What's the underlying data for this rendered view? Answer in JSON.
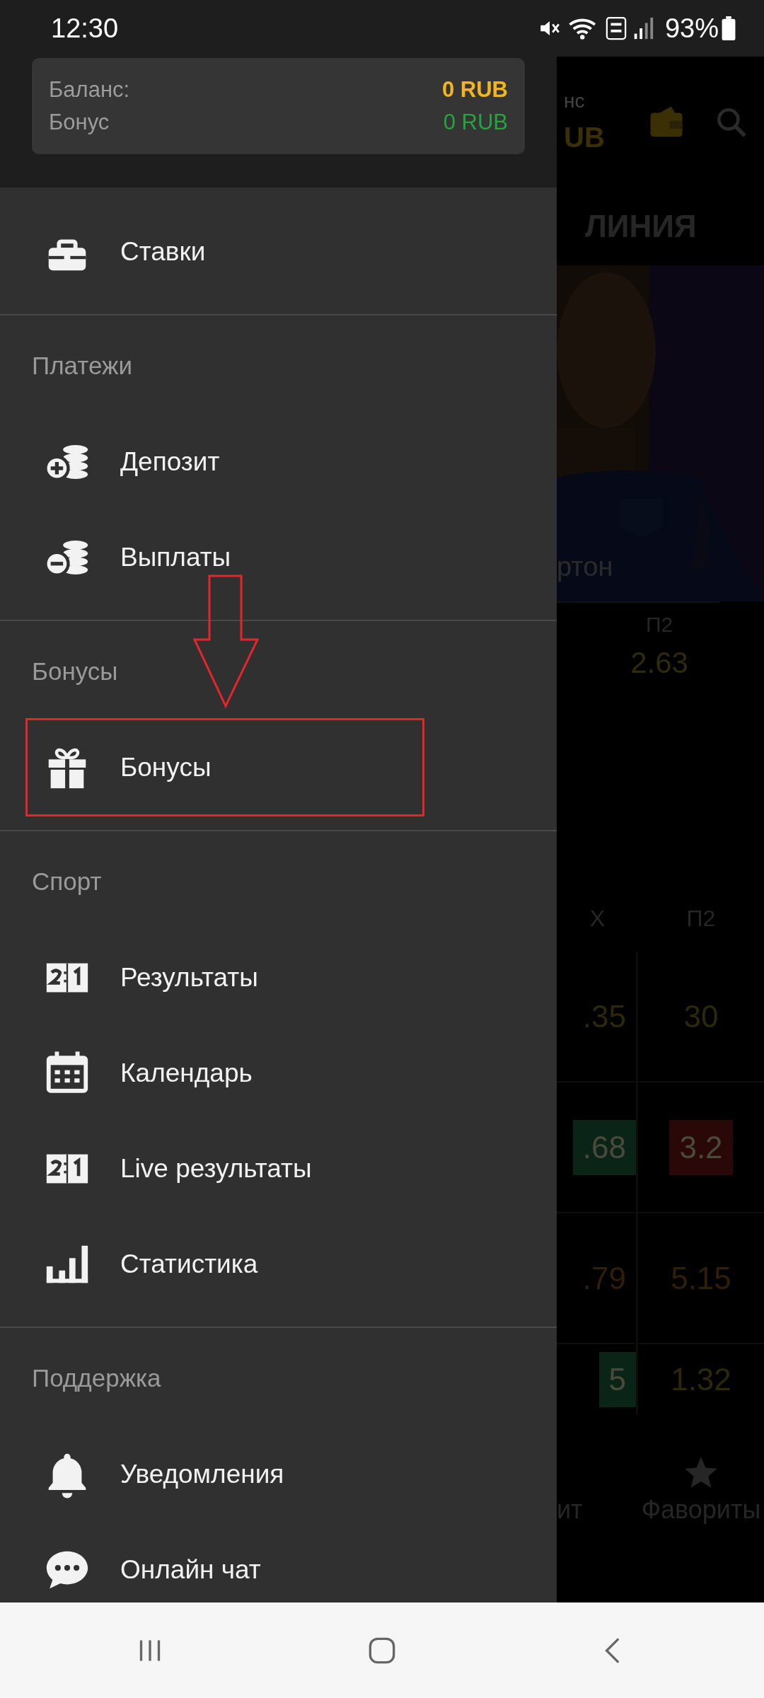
{
  "status_bar": {
    "time": "12:30",
    "battery": "93%"
  },
  "balance_card": {
    "balance_label": "Баланс:",
    "balance_value": "0 RUB",
    "bonus_label": "Бонус",
    "bonus_value": "0 RUB"
  },
  "menu": [
    {
      "items": [
        {
          "label": "Ставки",
          "highlighted": false
        }
      ]
    },
    {
      "title": "Платежи",
      "items": [
        {
          "label": "Депозит",
          "highlighted": false
        },
        {
          "label": "Выплаты",
          "highlighted": false
        }
      ]
    },
    {
      "title": "Бонусы",
      "items": [
        {
          "label": "Бонусы",
          "highlighted": true
        }
      ]
    },
    {
      "title": "Спорт",
      "items": [
        {
          "label": "Результаты",
          "highlighted": false
        },
        {
          "label": "Календарь",
          "highlighted": false
        },
        {
          "label": "Live результаты",
          "highlighted": false
        },
        {
          "label": "Статистика",
          "highlighted": false
        }
      ]
    },
    {
      "title": "Поддержка",
      "items": [
        {
          "label": "Уведомления",
          "highlighted": false
        },
        {
          "label": "Онлайн чат",
          "highlighted": false
        }
      ]
    }
  ],
  "background_app": {
    "balance_label_fragment": "нс",
    "balance_fragment": "UB",
    "tab": "ЛИНИЯ",
    "team_fragment": "ртон",
    "odds_header": "П2",
    "odds_value": "2.63",
    "table": {
      "columns": [
        "Х",
        "П2"
      ],
      "rows": [
        [
          {
            "text": ".35"
          },
          {
            "text": "30"
          }
        ],
        [
          {
            "text": ".68",
            "color": "#0b2418"
          },
          {
            "text": "3.2",
            "color": "#2a0808"
          }
        ],
        [
          {
            "text": ".79"
          },
          {
            "text": "5.15"
          }
        ],
        [
          {
            "text": "5",
            "color": "#0b2418"
          },
          {
            "text": "1.32"
          }
        ]
      ]
    },
    "nav": [
      {
        "label": "ит"
      },
      {
        "label": "Фавориты"
      }
    ]
  }
}
